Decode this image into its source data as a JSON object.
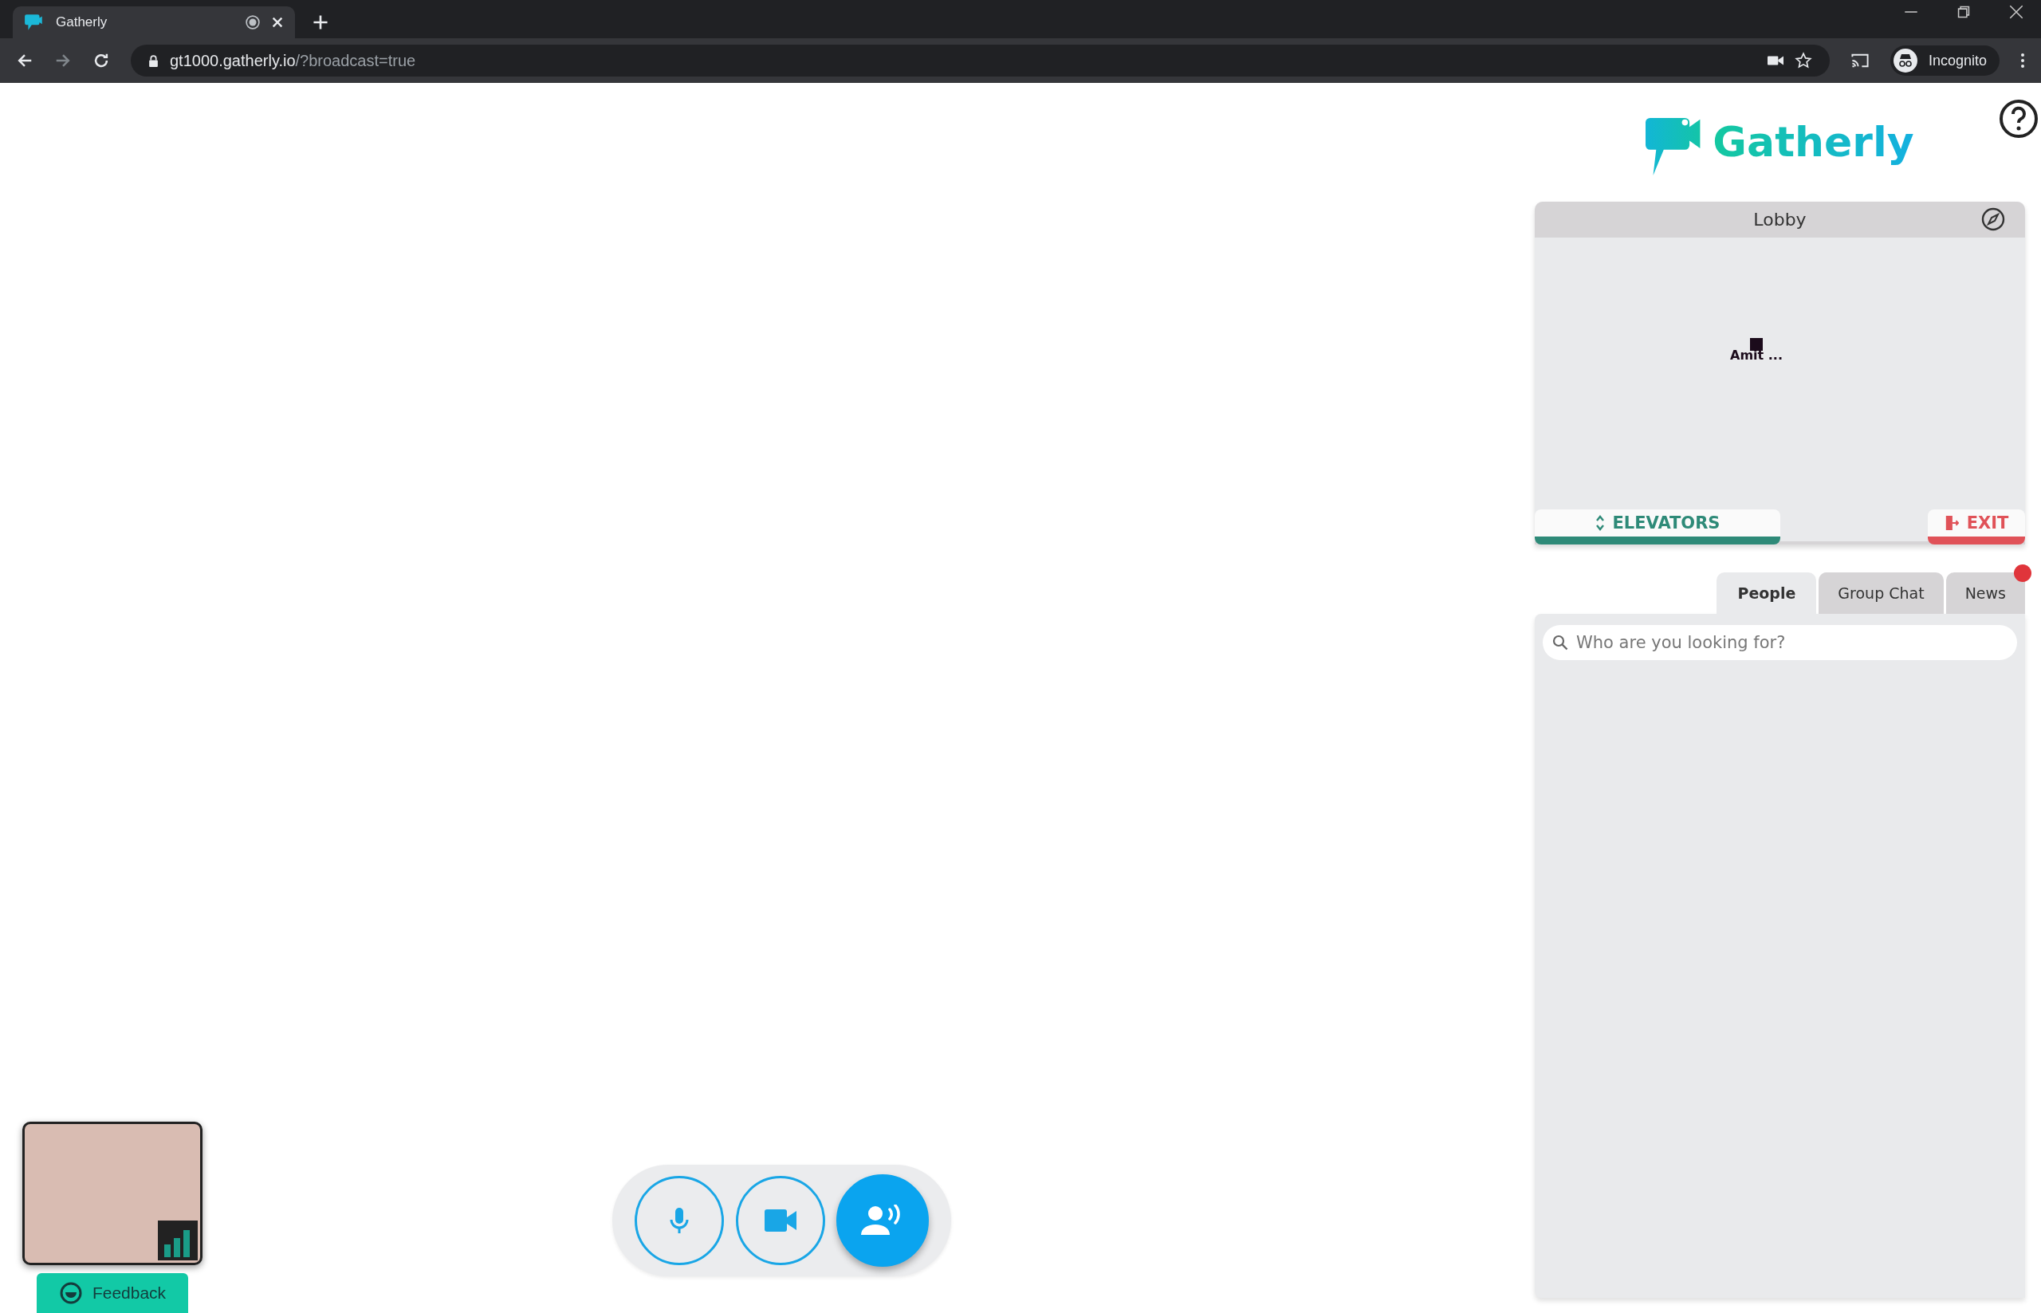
{
  "browser": {
    "tab": {
      "title": "Gatherly",
      "media_playing": true
    },
    "address": {
      "host": "gt1000.gatherly.io",
      "path": "/?broadcast=true"
    },
    "profile": "Incognito"
  },
  "app": {
    "logo": "Gatherly",
    "room": {
      "title": "Lobby",
      "participants": [
        {
          "name": "Amit ..."
        }
      ],
      "elevators": "ELEVATORS",
      "exit": "EXIT"
    },
    "tabs": [
      {
        "label": "People",
        "selected": true,
        "notification": false
      },
      {
        "label": "Group Chat",
        "selected": false,
        "notification": false
      },
      {
        "label": "News",
        "selected": false,
        "notification": true
      }
    ],
    "search": {
      "placeholder": "Who are you looking for?"
    },
    "controls": [
      {
        "kind": "mic",
        "active": false
      },
      {
        "kind": "camera",
        "active": false
      },
      {
        "kind": "broadcast",
        "active": true
      }
    ],
    "feedback": "Feedback"
  }
}
